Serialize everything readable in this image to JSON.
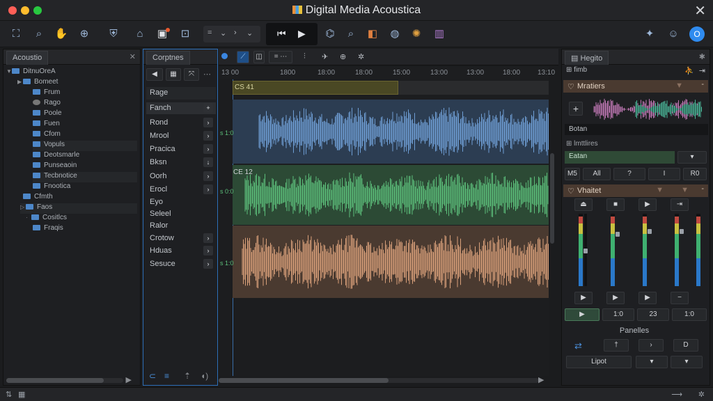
{
  "window": {
    "title": "Digital Media Acoustica",
    "colors": {
      "close": "#ff5f57",
      "minimize": "#febc2e",
      "maximize": "#28c840"
    }
  },
  "toolbar": {
    "icons": [
      "frame-icon",
      "search-icon",
      "hand-icon",
      "zoom-icon",
      "shield-icon",
      "tree-icon",
      "record-icon",
      "export-icon"
    ],
    "transport": {
      "prev": "⏮",
      "play": "▶"
    },
    "right_icons": [
      "library-icon",
      "search-icon",
      "tag-icon",
      "globe-icon",
      "settings-icon",
      "book-icon"
    ],
    "avatar_label": "O"
  },
  "browser": {
    "tab": "Acoustio",
    "root": "DitnuOreA",
    "items": [
      "Bomeet",
      "Frum",
      "Rago",
      "Poole",
      "Fuen",
      "Cfom",
      "Vopuls",
      "Deotsmarle",
      "Punseaoin",
      "Tecbnotice",
      "Fnootica"
    ],
    "group2": "Cfmth",
    "items2": [
      "Faos",
      "Cositlcs",
      "Fraqis"
    ]
  },
  "categories": {
    "tab": "Corptnes",
    "header": "Rage",
    "selected": "Fanch",
    "items": [
      "Rond",
      "Mrool",
      "Pracica",
      "Bksn",
      "Oorh",
      "Erocl",
      "Eyo",
      "Seleel",
      "Ralor",
      "Crotow",
      "Hduas",
      "Sesuce"
    ]
  },
  "arrange": {
    "ruler": [
      "13 00",
      "1800",
      "18:00",
      "18:00",
      "15:00",
      "13:00",
      "13:00",
      "18:00",
      "13:10"
    ],
    "region1_label": "CS 41",
    "region2_label": "CE 12",
    "track_gain_labels": [
      "s 1:0",
      "s 0:0",
      "s 1:0"
    ],
    "colors": {
      "track1": "#6f9fd6",
      "track2": "#5cbf7a",
      "track3": "#d9a07a",
      "region": "#5e5a2a"
    }
  },
  "inspector": {
    "tab": "Hegito",
    "submenu": "fimb",
    "section1": "Mratiers",
    "field1": "Botan",
    "section_label": "lmttlires",
    "field2": "Eatan",
    "buttons": [
      "M5",
      "All",
      "?",
      "I",
      "R0"
    ],
    "section2": "Vhaitet",
    "values": [
      "1:0",
      "23",
      "1:0"
    ],
    "panel_label": "Panelles",
    "output": "Lipot"
  }
}
